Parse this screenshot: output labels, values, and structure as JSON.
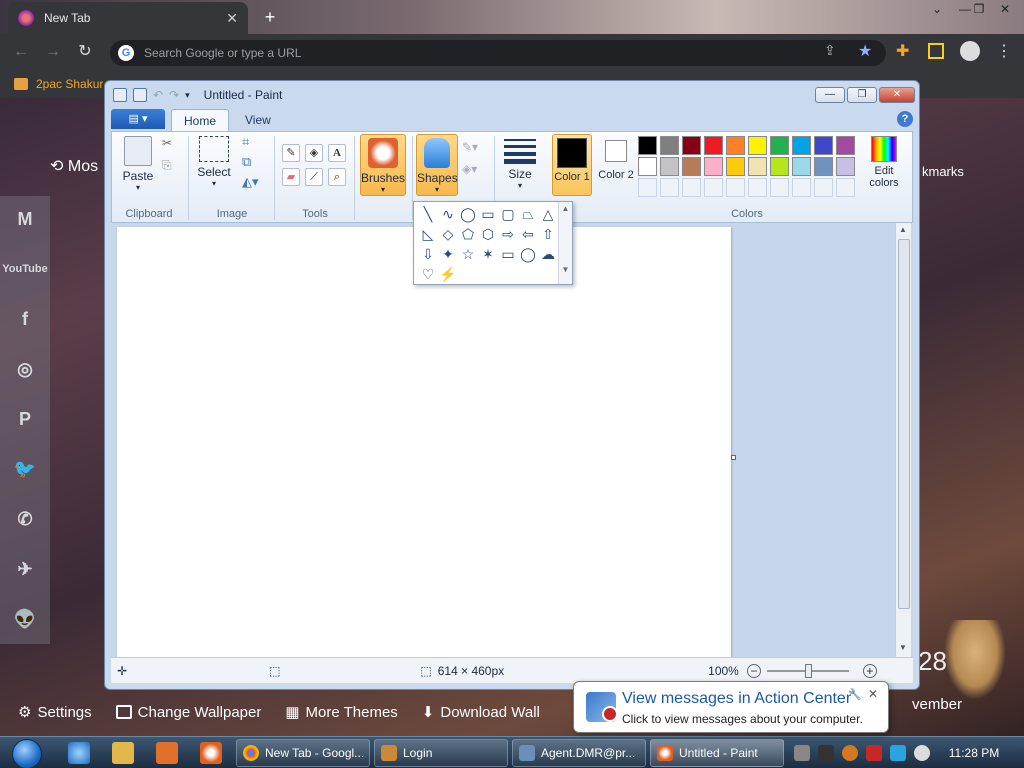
{
  "browser": {
    "tab_title": "New Tab",
    "omnibox_placeholder": "Search Google or type a URL",
    "bookmark": "2pac Shakur",
    "newtab": {
      "most_visited": "Mos",
      "bookmarks": "kmarks",
      "social": [
        "M",
        "YouTube",
        "f",
        "◎",
        "P",
        "🐦",
        "✆",
        "✈",
        "👽"
      ],
      "bottom_links": [
        "Settings",
        "Change Wallpaper",
        "More Themes",
        "Download Wall"
      ],
      "date_fragment": "vember",
      "day_fragment": "28"
    }
  },
  "paint": {
    "title": "Untitled - Paint",
    "tabs": {
      "home": "Home",
      "view": "View"
    },
    "groups": {
      "clipboard": "Clipboard",
      "image": "Image",
      "tools": "Tools",
      "colors": "Colors"
    },
    "buttons": {
      "paste": "Paste",
      "select": "Select",
      "brushes": "Brushes",
      "shapes": "Shapes",
      "size": "Size",
      "color1": "Color 1",
      "color2": "Color 2",
      "edit_colors": "Edit colors"
    },
    "palette": {
      "row1": [
        "#000000",
        "#7f7f7f",
        "#880015",
        "#ed1c24",
        "#ff7f27",
        "#fff200",
        "#22b14c",
        "#00a2e8",
        "#3f48cc",
        "#a349a4"
      ],
      "row2": [
        "#ffffff",
        "#c3c3c3",
        "#b97a57",
        "#ffaec9",
        "#ffc90e",
        "#efe4b0",
        "#b5e61d",
        "#99d9ea",
        "#7092be",
        "#c8bfe7"
      ]
    },
    "color1": "#000000",
    "color2": "#ffffff",
    "status": {
      "dimensions": "614 × 460px",
      "zoom": "100%"
    }
  },
  "balloon": {
    "title": "View messages in Action Center",
    "body": "Click to view messages about your computer."
  },
  "taskbar": {
    "windows": [
      "New Tab - Googl...",
      "Login",
      "Agent.DMR@pr...",
      "Untitled - Paint"
    ],
    "clock": "11:28 PM"
  }
}
